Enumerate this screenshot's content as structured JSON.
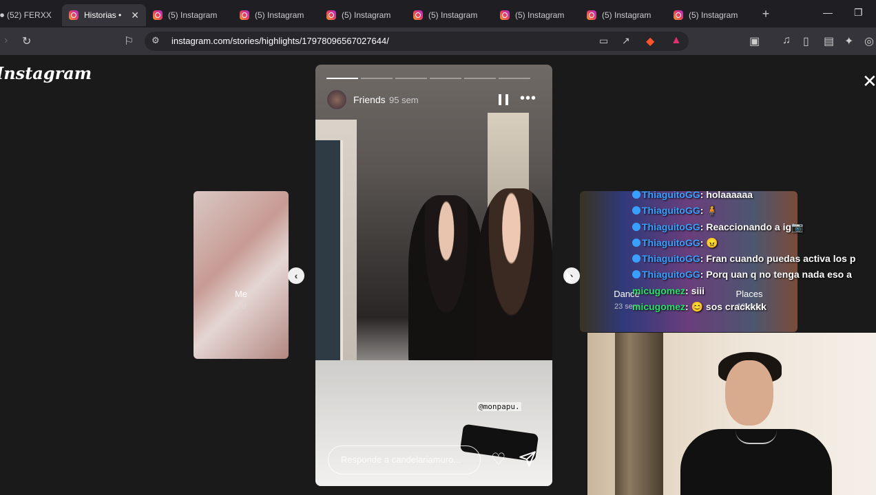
{
  "browser": {
    "tabs": [
      {
        "label": "(52) FERXX",
        "active": false
      },
      {
        "label": "Historias •",
        "active": true
      },
      {
        "label": "(5) Instagram",
        "active": false
      },
      {
        "label": "(5) Instagram",
        "active": false
      },
      {
        "label": "(5) Instagram",
        "active": false
      },
      {
        "label": "(5) Instagram",
        "active": false
      },
      {
        "label": "(5) Instagram",
        "active": false
      },
      {
        "label": "(5) Instagram",
        "active": false
      },
      {
        "label": "(5) Instagram",
        "active": false
      }
    ],
    "url": "instagram.com/stories/highlights/17978096567027644/",
    "new_tab_label": "+"
  },
  "page": {
    "logo": "Instagram",
    "close_symbol": "✕"
  },
  "prev_story": {
    "title": "Me",
    "time": "2 d"
  },
  "next_stories": [
    {
      "title": "Dance",
      "time": "23 sem"
    },
    {
      "title": "Places",
      "time": "19 sem"
    }
  ],
  "current_story": {
    "title": "Friends",
    "time": "95 sem",
    "mention": "@monpapu.",
    "reply_placeholder": "Responde a candelariamuro..."
  },
  "stream_chat": [
    {
      "user": "ThiaguitoGG",
      "message": "holaaaaaa",
      "badge": true
    },
    {
      "user": "ThiaguitoGG",
      "message": "",
      "badge": true
    },
    {
      "user": "ThiaguitoGG",
      "message": "Reaccionando a ig",
      "badge": true
    },
    {
      "user": "ThiaguitoGG",
      "message": "",
      "badge": true
    },
    {
      "user": "ThiaguitoGG",
      "message": "Fran cuando puedas activa los p",
      "badge": true
    },
    {
      "user": "ThiaguitoGG",
      "message": "Porq uan q no tenga nada eso a",
      "badge": true
    },
    {
      "user": "micugomez",
      "message": "siii",
      "badge": false
    },
    {
      "user": "micugomez",
      "message": "sos crackkkk",
      "badge": false
    }
  ]
}
